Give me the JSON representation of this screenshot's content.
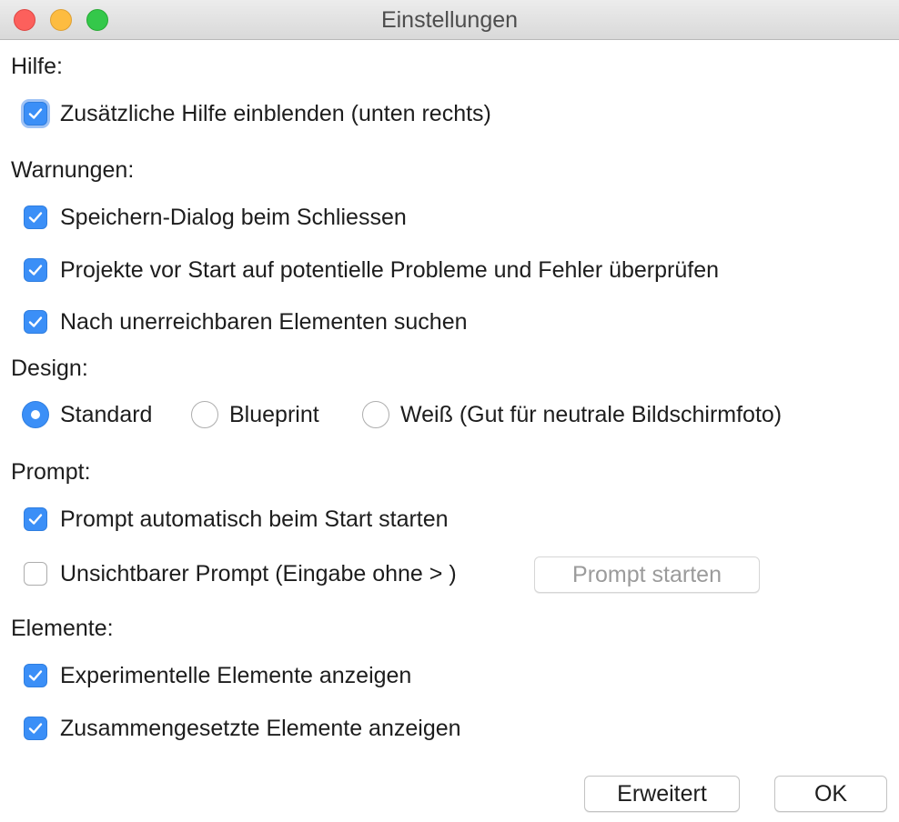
{
  "window": {
    "title": "Einstellungen"
  },
  "sections": {
    "hilfe": {
      "label": "Hilfe:",
      "options": [
        {
          "label": "Zusätzliche Hilfe einblenden (unten rechts)",
          "checked": true
        }
      ]
    },
    "warnungen": {
      "label": "Warnungen:",
      "options": [
        {
          "label": "Speichern-Dialog beim Schliessen",
          "checked": true
        },
        {
          "label": "Projekte vor Start auf potentielle Probleme und Fehler überprüfen",
          "checked": true
        },
        {
          "label": "Nach unerreichbaren Elementen suchen",
          "checked": true
        }
      ]
    },
    "design": {
      "label": "Design:",
      "options": [
        {
          "label": "Standard",
          "selected": true
        },
        {
          "label": "Blueprint",
          "selected": false
        },
        {
          "label": "Weiß (Gut für neutrale Bildschirmfoto)",
          "selected": false
        }
      ]
    },
    "prompt": {
      "label": "Prompt:",
      "options": [
        {
          "label": "Prompt automatisch beim Start starten",
          "checked": true
        },
        {
          "label": "Unsichtbarer Prompt (Eingabe ohne > )",
          "checked": false
        }
      ],
      "start_button": "Prompt starten"
    },
    "elemente": {
      "label": "Elemente:",
      "options": [
        {
          "label": "Experimentelle Elemente anzeigen",
          "checked": true
        },
        {
          "label": "Zusammengesetzte Elemente anzeigen",
          "checked": true
        }
      ]
    }
  },
  "footer": {
    "advanced_button": "Erweitert",
    "ok_button": "OK"
  },
  "colors": {
    "accent": "#3b8ff7",
    "title_text": "#4d4d4d"
  }
}
